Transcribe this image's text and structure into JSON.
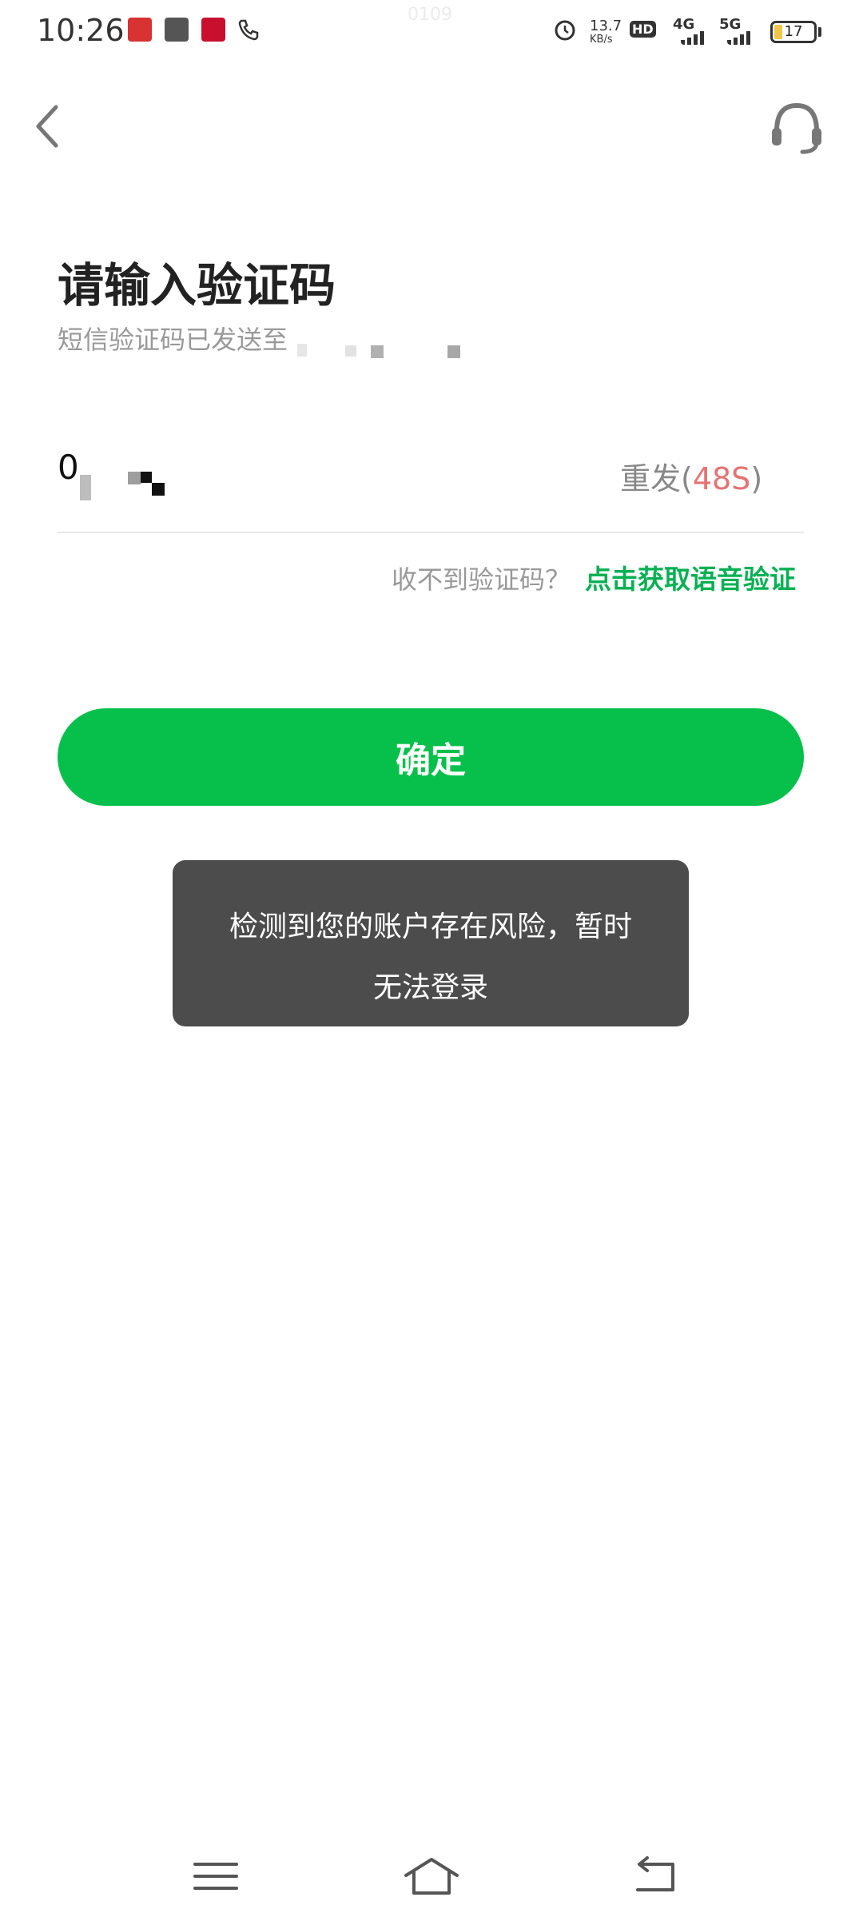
{
  "status_bar": {
    "time": "10:26",
    "watermark": "0109",
    "net_speed_value": "13.7",
    "net_speed_unit": "KB/s",
    "hd_label": "HD",
    "sim_4g": "4G",
    "sim_5g": "5G",
    "battery": "17",
    "colors": {
      "app1": "#d83232",
      "app2": "#555555",
      "app3": "#c8102e"
    }
  },
  "header": {
    "back_icon": "chevron-left-icon",
    "support_icon": "headset-icon"
  },
  "main": {
    "title": "请输入验证码",
    "subtitle": "短信验证码已发送至",
    "code_value": "0",
    "resend_label": "重发(",
    "resend_countdown": "48S",
    "resend_suffix": ")",
    "hint_text": "收不到验证码？",
    "voice_link": "点击获取语音验证",
    "confirm_label": "确定"
  },
  "toast": {
    "line1": "检测到您的账户存在风险，暂时",
    "line2": "无法登录"
  },
  "colors": {
    "accent": "#07c04b",
    "link": "#07b053",
    "countdown": "#e57373",
    "toast_bg": "#4c4c4c"
  },
  "nav": {
    "menu_icon": "menu-icon",
    "home_icon": "home-icon",
    "back_icon": "back-arrow-icon"
  }
}
